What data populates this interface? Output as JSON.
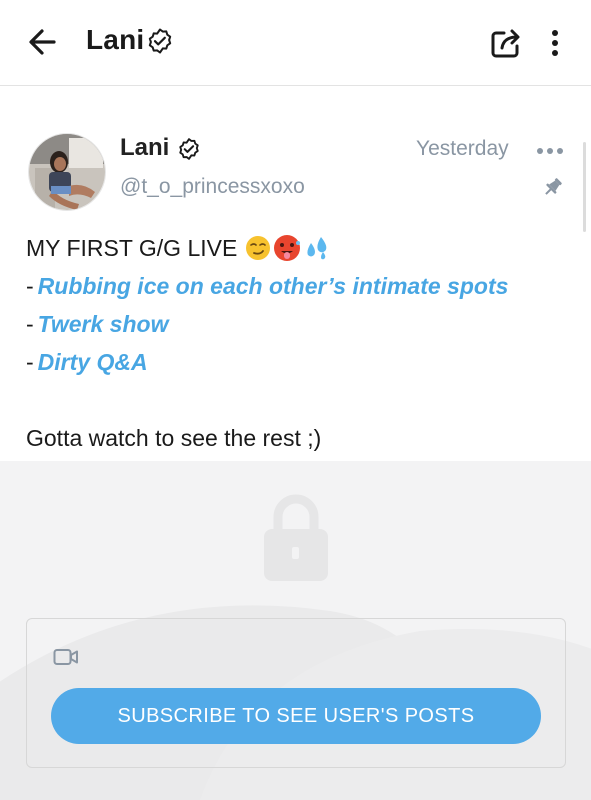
{
  "header": {
    "title": "Lani",
    "back_icon": "arrow-left-icon",
    "verified_icon": "verified-badge-icon",
    "share_icon": "share-icon",
    "menu_icon": "more-vertical-icon"
  },
  "post": {
    "author_name": "Lani",
    "author_handle": "@t_o_princessxoxo",
    "timestamp": "Yesterday",
    "menu_icon": "more-horizontal-icon",
    "pin_icon": "pin-icon",
    "lines": {
      "first": "MY FIRST G/G LIVE",
      "bullet1_prefix": "-",
      "bullet1": "Rubbing ice on each other’s intimate spots",
      "bullet2_prefix": "-",
      "bullet2": "Twerk show",
      "bullet3_prefix": "-",
      "bullet3": "Dirty Q&A",
      "closing": "Gotta watch to see the rest ;)"
    },
    "emojis": [
      "smirking-face",
      "hot-face",
      "sweat-droplets"
    ]
  },
  "locked": {
    "lock_icon": "lock-icon",
    "media_icon": "video-camera-icon",
    "subscribe_label": "SUBSCRIBE TO SEE USER'S POSTS"
  },
  "colors": {
    "accent": "#52aae8",
    "link": "#48a6e3",
    "muted": "#8a96a3",
    "locked_bg": "#f3f3f4"
  }
}
